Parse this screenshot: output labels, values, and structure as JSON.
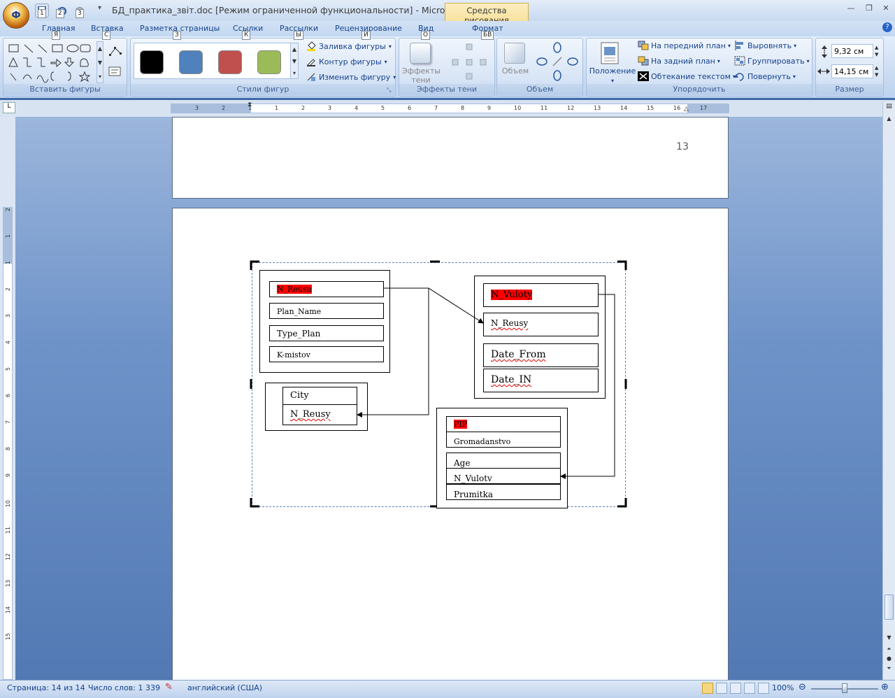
{
  "window": {
    "title": "БД_практика_звіт.doc [Режим ограниченной функциональности] - Microsoft...",
    "context_tab_group": "Средства рисования",
    "office_button_label": "Ф"
  },
  "qat": {
    "key_labels": [
      "1",
      "2",
      "3"
    ]
  },
  "tabs": [
    {
      "label": "Главная",
      "key": "Я"
    },
    {
      "label": "Вставка",
      "key": "С"
    },
    {
      "label": "Разметка страницы",
      "key": "З"
    },
    {
      "label": "Ссылки",
      "key": "К"
    },
    {
      "label": "Рассылки",
      "key": "Ы"
    },
    {
      "label": "Рецензирование",
      "key": "И"
    },
    {
      "label": "Вид",
      "key": "О"
    },
    {
      "label": "Формат",
      "key": "БВ"
    }
  ],
  "ribbon": {
    "groups": {
      "insert_shapes": "Вставить фигуры",
      "shape_styles": "Стили фигур",
      "shadow_effects": "Эффекты тени",
      "volume": "Объем",
      "arrange": "Упорядочить",
      "size": "Размер"
    },
    "shape_fill": "Заливка фигуры",
    "shape_outline": "Контур фигуры",
    "change_shape": "Изменить фигуру",
    "shadow_effects_btn_1": "Эффекты",
    "shadow_effects_btn_2": "тени",
    "volume_btn": "Объем",
    "position": "Положение",
    "bring_front": "На передний план",
    "send_back": "На задний план",
    "text_wrap": "Обтекание текстом",
    "align": "Выровнять",
    "group": "Группировать",
    "rotate": "Повернуть",
    "height": "9,32 см",
    "width": "14,15 см",
    "swatch_colors": [
      "#000000",
      "#4f81bd",
      "#c0504d",
      "#9bbb59"
    ]
  },
  "ruler": {
    "h_ticks": [
      "3",
      "2",
      "1",
      "1",
      "2",
      "3",
      "4",
      "5",
      "6",
      "7",
      "8",
      "9",
      "10",
      "11",
      "12",
      "13",
      "14",
      "15",
      "16",
      "17"
    ],
    "v_ticks": [
      "2",
      "1",
      "1",
      "2",
      "3",
      "4",
      "5",
      "6",
      "7",
      "8",
      "9",
      "10",
      "11",
      "12",
      "13",
      "14",
      "15"
    ]
  },
  "document": {
    "page_number": "13",
    "diagram": {
      "plan_box": [
        "N_Reusu",
        "Plan_Name",
        "Type_Plan",
        "K-mistov"
      ],
      "city_box": [
        "City",
        "N_Reusy"
      ],
      "vuloty_box": [
        "N_Vuloty",
        "N_Reusy",
        "Date_From",
        "Date_IN"
      ],
      "pip_box": [
        "PIP",
        "Gromadanstvo",
        "Age",
        "N_Vulotv",
        "Prumitka"
      ]
    }
  },
  "status": {
    "page": "Страница: 14 из 14",
    "words": "Число слов: 1 339",
    "language": "английский (США)",
    "zoom": "100%"
  }
}
